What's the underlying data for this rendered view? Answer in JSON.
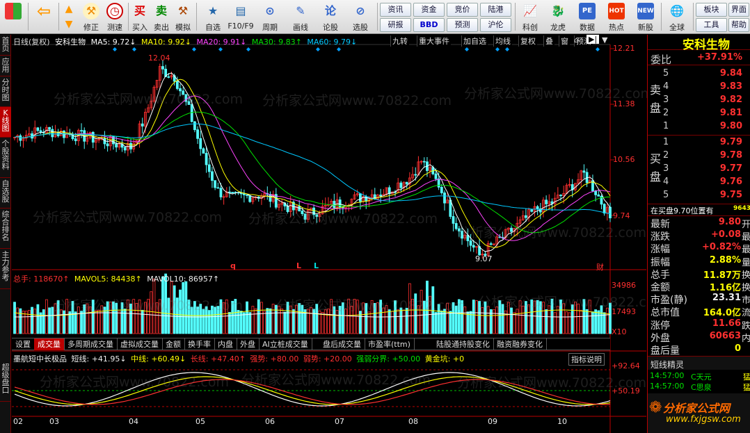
{
  "toolbar": {
    "buttons": [
      "修正",
      "测速",
      "买入",
      "卖出",
      "模拟",
      "自选",
      "F10/F9",
      "周期",
      "画线",
      "论股",
      "选股",
      "资讯",
      "资金",
      "竞价",
      "陆港",
      "研报",
      "BBD",
      "预测",
      "沪伦",
      "科创",
      "龙虎",
      "数据",
      "热点",
      "新股",
      "全球",
      "板块",
      "工具",
      "界面",
      "帮助"
    ]
  },
  "lefttabs": [
    "首页",
    "应用",
    "分时图",
    "K线图",
    "个股资料",
    "自选股",
    "综合排名",
    "主力参考",
    "超级盘口"
  ],
  "chart": {
    "header": {
      "period": "日线(复权)",
      "stock": "安科生物",
      "ma5": "MA5: 9.72↓",
      "ma10": "MA10: 9.92↓",
      "ma20": "MA20: 9.91↓",
      "ma30": "MA30: 9.83↑",
      "ma60": "MA60: 9.79↓"
    },
    "right_buttons": [
      "九转",
      "重大事件",
      "加自选",
      "均线",
      "复权",
      "叠",
      "窗",
      "预测"
    ],
    "price_axis": [
      "12.21",
      "11.38",
      "10.56",
      "9.74"
    ],
    "high_label": "12.04",
    "low_label": "9.07",
    "markers": [
      "q",
      "L",
      "L",
      "财"
    ],
    "vol_header": {
      "label": "总手: 118670↑",
      "mavol5": "MAVOL5: 84438↑",
      "mavol10": "MAVOL10: 86957↑"
    },
    "vol_axis": [
      "34986",
      "17493",
      "X10"
    ],
    "bottom_tabs": [
      "设置",
      "成交量",
      "多周期成交量",
      "虚拟成交量",
      "金额",
      "换手率",
      "内盘",
      "外盘",
      "AI立桩成交量",
      "盘后成交量",
      "市盈率(ttm)",
      "陆股通持股变化",
      "融资融券变化"
    ],
    "ind_header": {
      "name": "墨航短中长极品",
      "short": "短线: +41.95↓",
      "mid": "中线: +60.49↓",
      "long": "长线: +47.40↑",
      "strong": "强势: +80.00",
      "weak": "弱势: +20.00",
      "bound": "强弱分界: +50.00",
      "gold": "黄金坑: +0"
    },
    "ind_button": "指标说明",
    "ind_axis": [
      "+92.64",
      "+50.19"
    ],
    "months": [
      "02",
      "03",
      "04",
      "05",
      "06",
      "07",
      "08",
      "09",
      "10"
    ],
    "watermark": "分析家公式网www.70822.com"
  },
  "quote": {
    "name": "安科生物",
    "r": "R",
    "weibi_label": "委比",
    "weibi": "+37.91%",
    "sell_label": "卖盘",
    "sells": [
      [
        "5",
        "9.84"
      ],
      [
        "4",
        "9.83"
      ],
      [
        "3",
        "9.82"
      ],
      [
        "2",
        "9.81"
      ],
      [
        "1",
        "9.80"
      ]
    ],
    "buy_label": "买盘",
    "buys": [
      [
        "1",
        "9.79"
      ],
      [
        "2",
        "9.78"
      ],
      [
        "3",
        "9.77"
      ],
      [
        "4",
        "9.76"
      ],
      [
        "5",
        "9.75"
      ]
    ],
    "position": "在买盘9.70位置有",
    "position_val": "9643",
    "stats": [
      [
        "最新",
        "9.80",
        "开"
      ],
      [
        "涨跌",
        "+0.08",
        "最"
      ],
      [
        "涨幅",
        "+0.82%",
        "最"
      ],
      [
        "振幅",
        "2.88%",
        "量"
      ],
      [
        "总手",
        "11.87万",
        "换"
      ],
      [
        "金额",
        "1.16亿",
        "换"
      ],
      [
        "市盈(静)",
        "23.31",
        "市"
      ],
      [
        "总市值",
        "164.0亿",
        "流"
      ],
      [
        "涨停",
        "11.66",
        "跌"
      ],
      [
        "外盘",
        "60663",
        "内"
      ],
      [
        "盘后量",
        "0",
        ""
      ]
    ],
    "feed_title": "短线精灵",
    "feed": [
      [
        "14:57:00",
        "C天元",
        "猛"
      ],
      [
        "14:57:00",
        "C思泉",
        "猛"
      ]
    ],
    "logo": "分析家公式网",
    "logo_url": "www.fxjgsw.com"
  }
}
